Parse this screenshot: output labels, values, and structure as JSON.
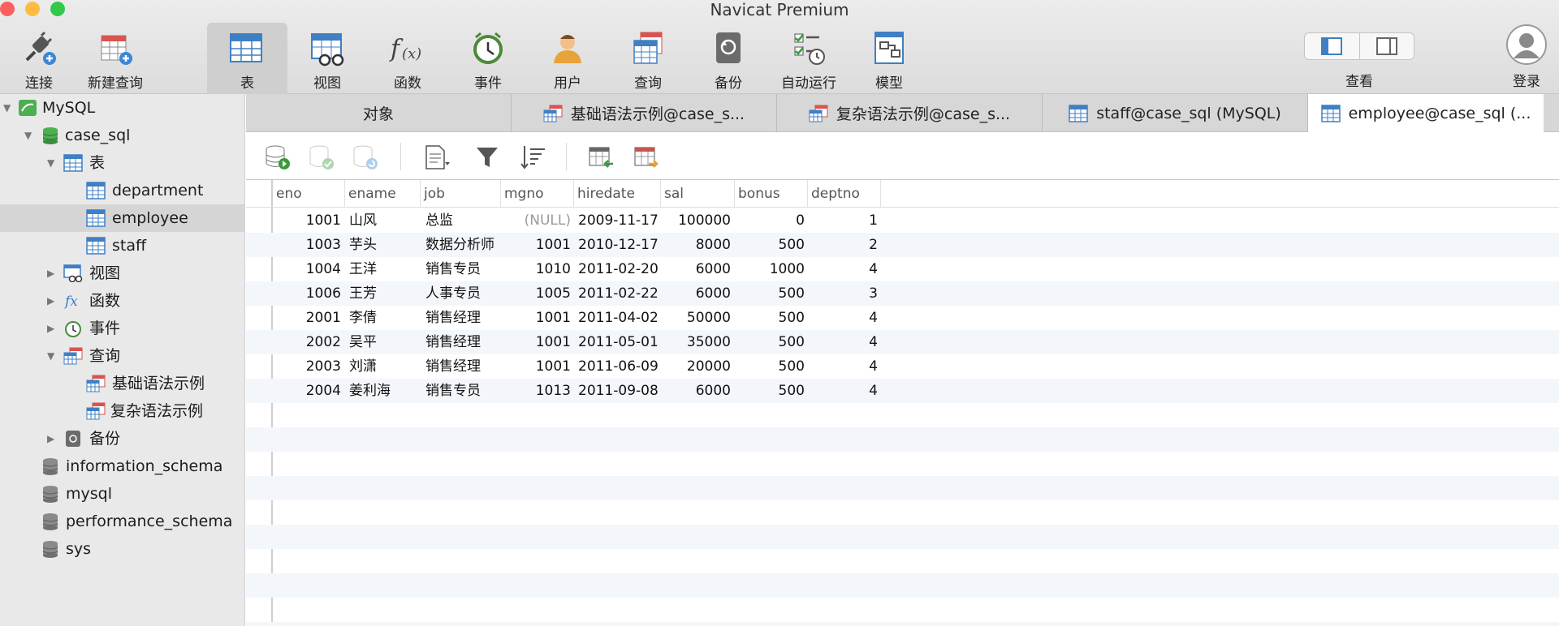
{
  "window": {
    "title": "Navicat Premium"
  },
  "toolbar": {
    "items": [
      {
        "label": "连接",
        "icon": "plug-connect-icon"
      },
      {
        "label": "新建查询",
        "icon": "new-query-icon"
      },
      {
        "label": "表",
        "icon": "table-icon",
        "active": true
      },
      {
        "label": "视图",
        "icon": "view-icon"
      },
      {
        "label": "函数",
        "icon": "function-icon"
      },
      {
        "label": "事件",
        "icon": "clock-event-icon"
      },
      {
        "label": "用户",
        "icon": "user-icon"
      },
      {
        "label": "查询",
        "icon": "query-icon"
      },
      {
        "label": "备份",
        "icon": "backup-icon"
      },
      {
        "label": "自动运行",
        "icon": "automation-icon"
      },
      {
        "label": "模型",
        "icon": "model-icon"
      }
    ],
    "view_label": "查看",
    "login_label": "登录"
  },
  "sidebar": {
    "connection": "MySQL",
    "database": "case_sql",
    "tables_group": "表",
    "tables": [
      "department",
      "employee",
      "staff"
    ],
    "views_group": "视图",
    "functions_group": "函数",
    "events_group": "事件",
    "queries_group": "查询",
    "queries": [
      "基础语法示例",
      "复杂语法示例"
    ],
    "backup_group": "备份",
    "other_databases": [
      "information_schema",
      "mysql",
      "performance_schema",
      "sys"
    ],
    "selected": "employee"
  },
  "tabs": [
    {
      "label": "对象",
      "icon": ""
    },
    {
      "label": "基础语法示例@case_s...",
      "icon": "query-icon"
    },
    {
      "label": "复杂语法示例@case_s...",
      "icon": "query-icon"
    },
    {
      "label": "staff@case_sql (MySQL)",
      "icon": "table-icon"
    },
    {
      "label": "employee@case_sql (...",
      "icon": "table-icon",
      "active": true
    }
  ],
  "grid": {
    "columns": [
      "eno",
      "ename",
      "job",
      "mgno",
      "hiredate",
      "sal",
      "bonus",
      "deptno"
    ],
    "rows": [
      [
        "1001",
        "山风",
        "总监",
        "(NULL)",
        "2009-11-17",
        "100000",
        "0",
        "1"
      ],
      [
        "1003",
        "芋头",
        "数据分析师",
        "1001",
        "2010-12-17",
        "8000",
        "500",
        "2"
      ],
      [
        "1004",
        "王洋",
        "销售专员",
        "1010",
        "2011-02-20",
        "6000",
        "1000",
        "4"
      ],
      [
        "1006",
        "王芳",
        "人事专员",
        "1005",
        "2011-02-22",
        "6000",
        "500",
        "3"
      ],
      [
        "2001",
        "李倩",
        "销售经理",
        "1001",
        "2011-04-02",
        "50000",
        "500",
        "4"
      ],
      [
        "2002",
        "吴平",
        "销售经理",
        "1001",
        "2011-05-01",
        "35000",
        "500",
        "4"
      ],
      [
        "2003",
        "刘潇",
        "销售经理",
        "1001",
        "2011-06-09",
        "20000",
        "500",
        "4"
      ],
      [
        "2004",
        "姜利海",
        "销售专员",
        "1013",
        "2011-09-08",
        "6000",
        "500",
        "4"
      ]
    ]
  },
  "colors": {
    "accent_table": "#3f7fc4",
    "db_green": "#4caf50",
    "selected_row": "#d5d5d5"
  }
}
